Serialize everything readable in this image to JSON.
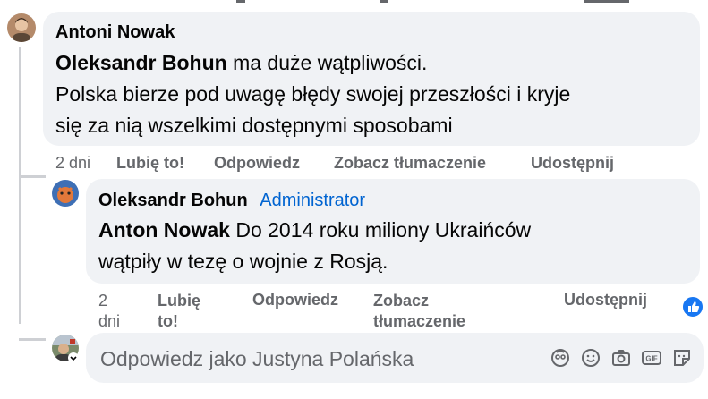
{
  "comment1": {
    "author": "Antoni Nowak",
    "mention": "Oleksandr Bohun",
    "text_line1": " ma duże wątpliwości.",
    "text_line2": "Polska bierze pod uwagę błędy swojej przeszłości i kryje",
    "text_line3": "się za nią wszelkimi dostępnymi sposobami",
    "time": "2 dni",
    "like": "Lubię to!",
    "reply": "Odpowiedz",
    "translate": "Zobacz tłumaczenie",
    "share": "Udostępnij"
  },
  "comment2": {
    "author": "Oleksandr Bohun",
    "badge": "Administrator",
    "mention": "Anton Nowak",
    "text_line1": " Do 2014 roku miliony Ukraińców",
    "text_line2": "wątpiły w tezę o wojnie z Rosją.",
    "time_line1": "2",
    "time_line2": "dni",
    "like_line1": "Lubię",
    "like_line2": "to!",
    "reply": "Odpowiedz",
    "translate_line1": "Zobacz",
    "translate_line2": "tłumaczenie",
    "share": "Udostępnij"
  },
  "reply_box": {
    "placeholder": "Odpowiedz jako Justyna Polańska"
  },
  "colors": {
    "bubble": "#f0f2f5",
    "meta_text": "#65676b",
    "admin_badge": "#0064d1",
    "like_blue": "#1877f2"
  },
  "icons": [
    "avatar-sticker-icon",
    "emoji-icon",
    "camera-icon",
    "gif-icon",
    "sticker-icon",
    "like-reaction-icon"
  ]
}
